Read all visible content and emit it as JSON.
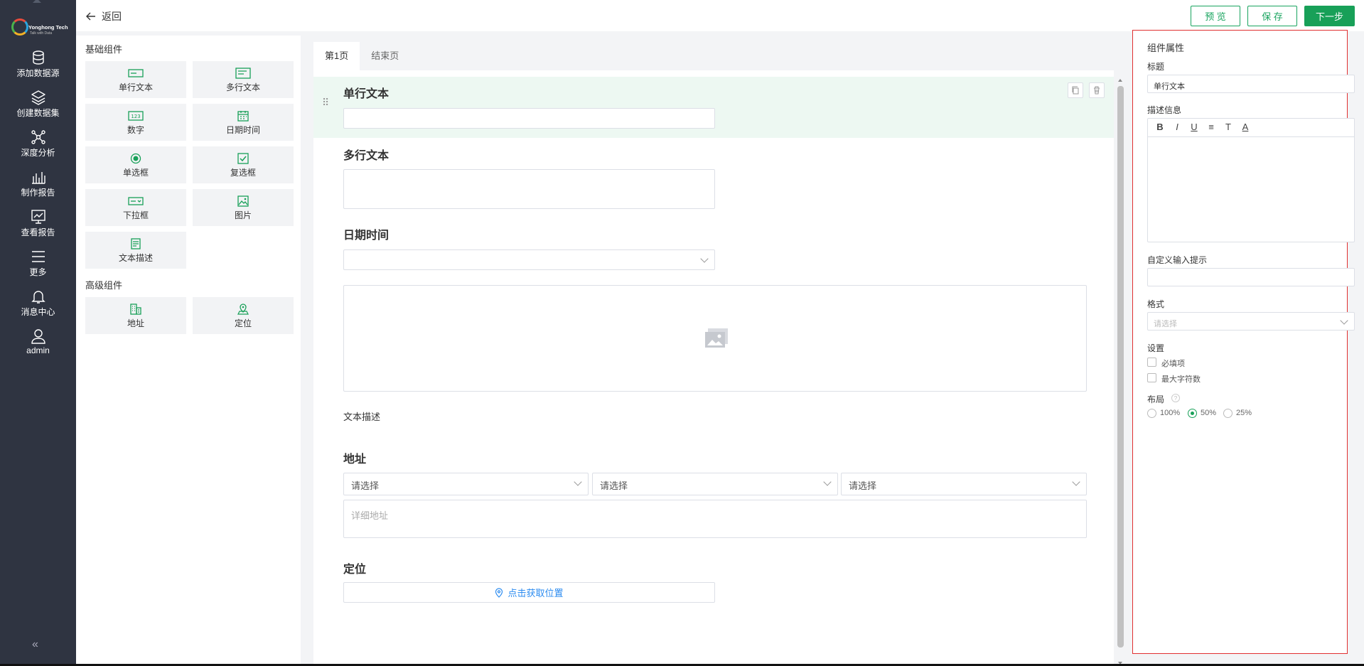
{
  "nav": {
    "logo_brand": "Yonghong Tech",
    "logo_tagline": "Talk with Data",
    "items": [
      {
        "label": "添加数据源",
        "icon": "database-icon"
      },
      {
        "label": "创建数据集",
        "icon": "layers-icon"
      },
      {
        "label": "深度分析",
        "icon": "network-icon"
      },
      {
        "label": "制作报告",
        "icon": "bar-chart-icon"
      },
      {
        "label": "查看报告",
        "icon": "monitor-chart-icon"
      },
      {
        "label": "更多",
        "icon": "menu-icon"
      },
      {
        "label": "消息中心",
        "icon": "bell-icon"
      },
      {
        "label": "admin",
        "icon": "user-icon"
      }
    ],
    "collapse_glyph": "«"
  },
  "topbar": {
    "back_label": "返回",
    "preview_label": "预 览",
    "save_label": "保 存",
    "next_label": "下一步",
    "accent_color": "#18a058"
  },
  "palette": {
    "basic_title": "基础组件",
    "basic_items": [
      {
        "label": "单行文本",
        "icon": "single-line-text-icon"
      },
      {
        "label": "多行文本",
        "icon": "multi-line-text-icon"
      },
      {
        "label": "数字",
        "icon": "number-icon"
      },
      {
        "label": "日期时间",
        "icon": "calendar-icon"
      },
      {
        "label": "单选框",
        "icon": "radio-icon"
      },
      {
        "label": "复选框",
        "icon": "checkbox-icon"
      },
      {
        "label": "下拉框",
        "icon": "dropdown-icon"
      },
      {
        "label": "图片",
        "icon": "image-icon"
      },
      {
        "label": "文本描述",
        "icon": "text-desc-icon"
      }
    ],
    "advanced_title": "高级组件",
    "advanced_items": [
      {
        "label": "地址",
        "icon": "building-icon"
      },
      {
        "label": "定位",
        "icon": "location-icon"
      }
    ]
  },
  "canvas": {
    "tabs": [
      {
        "label": "第1页"
      },
      {
        "label": "结束页"
      }
    ],
    "single_text_title": "单行文本",
    "multi_text_title": "多行文本",
    "datetime_title": "日期时间",
    "text_desc": "文本描述",
    "address_title": "地址",
    "select_placeholder": "请选择",
    "address_detail_placeholder": "详细地址",
    "location_title": "定位",
    "location_button": "点击获取位置"
  },
  "props": {
    "panel_title": "组件属性",
    "title_label": "标题",
    "title_value": "单行文本",
    "desc_label": "描述信息",
    "rte_buttons": [
      "B",
      "I",
      "U",
      "≡",
      "T",
      "A"
    ],
    "hint_label": "自定义输入提示",
    "format_label": "格式",
    "format_placeholder": "请选择",
    "settings_label": "设置",
    "required_label": "必填项",
    "maxlen_label": "最大字符数",
    "layout_label": "布局",
    "layout_help": "?",
    "layout_options": [
      {
        "label": "100%",
        "selected": false
      },
      {
        "label": "50%",
        "selected": true
      },
      {
        "label": "25%",
        "selected": false
      }
    ]
  }
}
